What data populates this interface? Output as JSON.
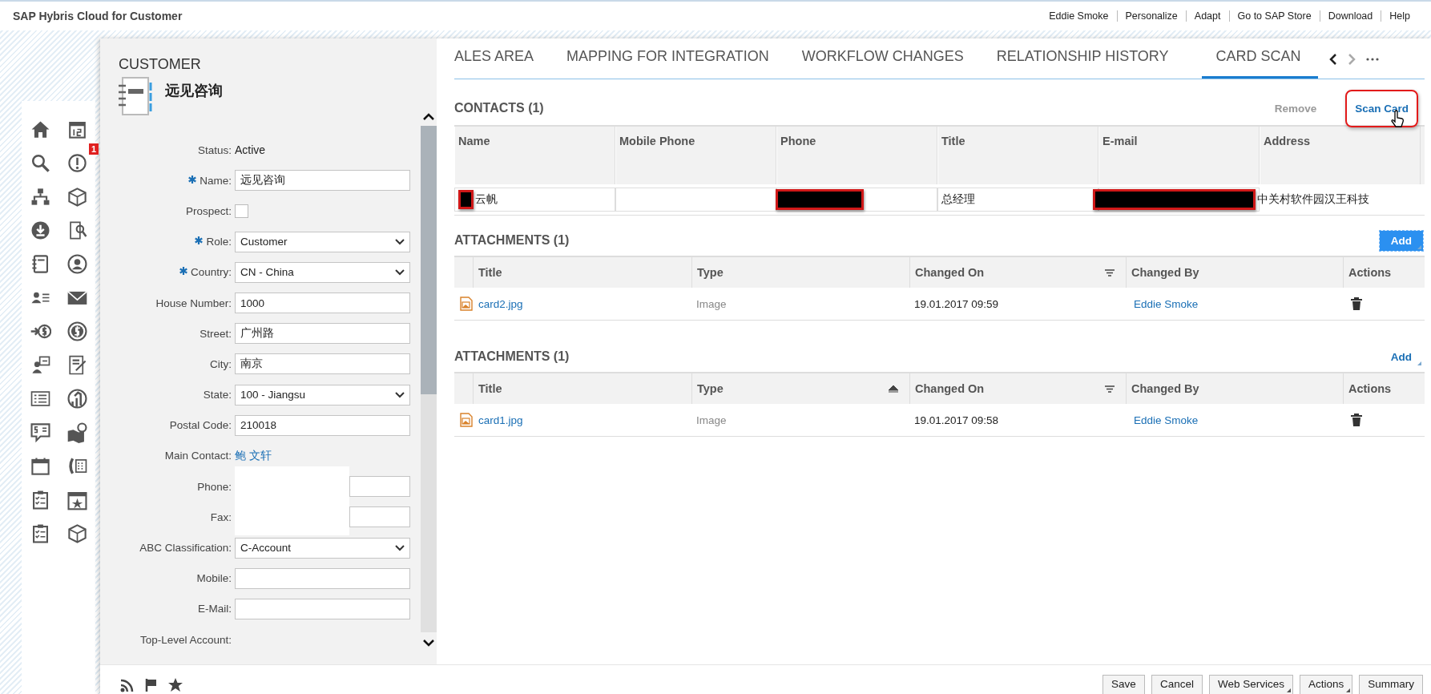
{
  "app_title": "SAP Hybris Cloud for Customer",
  "header_links": [
    "Eddie Smoke",
    "Personalize",
    "Adapt",
    "Go to SAP Store",
    "Download",
    "Help"
  ],
  "nav_badge": "1",
  "customer": {
    "heading": "CUSTOMER",
    "name": "远见咨询",
    "fields": [
      {
        "label": "Status:",
        "kind": "text",
        "value": "Active",
        "required": false
      },
      {
        "label": "Name:",
        "kind": "input",
        "value": "远见咨询",
        "required": true
      },
      {
        "label": "Prospect:",
        "kind": "checkbox",
        "checked": false,
        "required": false
      },
      {
        "label": "Role:",
        "kind": "select",
        "value": "Customer",
        "required": true
      },
      {
        "label": "Country:",
        "kind": "select",
        "value": "CN - China",
        "required": true
      },
      {
        "label": "House Number:",
        "kind": "input",
        "value": "1000",
        "required": false
      },
      {
        "label": "Street:",
        "kind": "input",
        "value": "广州路",
        "required": false
      },
      {
        "label": "City:",
        "kind": "input",
        "value": "南京",
        "required": false
      },
      {
        "label": "State:",
        "kind": "select",
        "value": "100 - Jiangsu",
        "required": false
      },
      {
        "label": "Postal Code:",
        "kind": "input",
        "value": "210018",
        "required": false
      },
      {
        "label": "Main Contact:",
        "kind": "link",
        "value": "鲍 文轩",
        "required": false
      },
      {
        "label": "Phone:",
        "kind": "input",
        "covered": true,
        "required": false
      },
      {
        "label": "Fax:",
        "kind": "input",
        "covered": true,
        "required": false
      },
      {
        "label": "ABC Classification:",
        "kind": "select",
        "value": "C-Account",
        "required": false
      },
      {
        "label": "Mobile:",
        "kind": "input",
        "required": false
      },
      {
        "label": "E-Mail:",
        "kind": "input",
        "required": false
      },
      {
        "label": "Top-Level Account:",
        "kind": "label",
        "required": false
      }
    ]
  },
  "tabs": [
    {
      "label": "ALES AREA",
      "selected": false
    },
    {
      "label": "MAPPING FOR INTEGRATION",
      "selected": false
    },
    {
      "label": "WORKFLOW CHANGES",
      "selected": false
    },
    {
      "label": "RELATIONSHIP HISTORY",
      "selected": false
    },
    {
      "label": "CARD SCAN",
      "selected": true
    }
  ],
  "contacts": {
    "title": "CONTACTS (1)",
    "actions": [
      {
        "label": "Remove",
        "disabled": true,
        "highlighted": false
      },
      {
        "label": "Scan Card",
        "disabled": false,
        "highlighted": true
      }
    ],
    "columns": [
      "Name",
      "Mobile Phone",
      "Phone",
      "Title",
      "E-mail",
      "Address"
    ],
    "rows": [
      {
        "cells": [
          {
            "kind": "partly_redacted",
            "text": "云帆"
          },
          {
            "kind": "text"
          },
          {
            "kind": "redacted"
          },
          {
            "kind": "text",
            "text": "总经理"
          },
          {
            "kind": "redacted"
          },
          {
            "kind": "text",
            "text": "中关村软件园汉王科技"
          }
        ]
      }
    ]
  },
  "attachments": [
    {
      "title": "ATTACHMENTS (1)",
      "add": {
        "label": "Add",
        "focused": true
      },
      "columns": [
        {
          "label": "Title",
          "filter": false,
          "sort_ascending": false
        },
        {
          "label": "Type",
          "filter": false,
          "sort_ascending": false
        },
        {
          "label": "Changed On",
          "filter": true,
          "sort_ascending": false
        },
        {
          "label": "Changed By",
          "filter": false,
          "sort_ascending": false
        },
        {
          "label": "Actions",
          "filter": false,
          "sort_ascending": false
        }
      ],
      "rows": [
        {
          "title": "card2.jpg",
          "type": "Image",
          "changed_on": "19.01.2017 09:59",
          "changed_by": "Eddie Smoke"
        }
      ]
    },
    {
      "title": "ATTACHMENTS (1)",
      "add": {
        "label": "Add",
        "focused": false
      },
      "columns": [
        {
          "label": "Title",
          "filter": false,
          "sort_ascending": false
        },
        {
          "label": "Type",
          "filter": false,
          "sort_ascending": true
        },
        {
          "label": "Changed On",
          "filter": true,
          "sort_ascending": false
        },
        {
          "label": "Changed By",
          "filter": false,
          "sort_ascending": false
        },
        {
          "label": "Actions",
          "filter": false,
          "sort_ascending": false
        }
      ],
      "rows": [
        {
          "title": "card1.jpg",
          "type": "Image",
          "changed_on": "19.01.2017 09:58",
          "changed_by": "Eddie Smoke"
        }
      ]
    }
  ],
  "footer_buttons": [
    {
      "label": "Save",
      "menu": false
    },
    {
      "label": "Cancel",
      "menu": false
    },
    {
      "label": "Web Services",
      "menu": true
    },
    {
      "label": "Actions",
      "menu": true
    },
    {
      "label": "Summary",
      "menu": false
    }
  ]
}
